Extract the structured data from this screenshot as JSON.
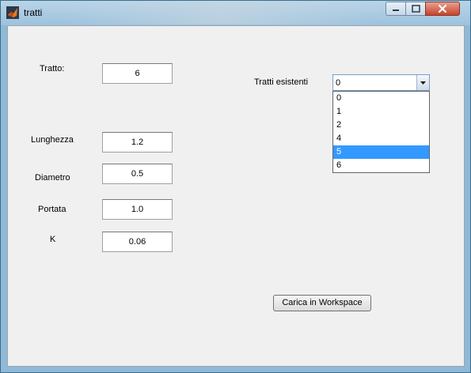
{
  "window": {
    "title": "tratti",
    "icon": "matlab-icon",
    "controls": [
      "minimize-icon",
      "maximize-icon",
      "close-icon"
    ]
  },
  "form": {
    "tratto_label": "Tratto:",
    "tratto_value": "6",
    "lunghezza_label": "Lunghezza",
    "lunghezza_value": "1.2",
    "diametro_label": "Diametro",
    "diametro_value": "0.5",
    "portata_label": "Portata",
    "portata_value": "1.0",
    "k_label": "K",
    "k_value": "0.06"
  },
  "existing": {
    "label": "Tratti esistenti",
    "selected_value": "0",
    "options": [
      "0",
      "1",
      "2",
      "4",
      "5",
      "6"
    ],
    "highlighted_option": "5"
  },
  "actions": {
    "load_button_label": "Carica in Workspace"
  },
  "colors": {
    "selection": "#3399ff",
    "client_bg": "#f0f0f0",
    "close_button": "#c7422b"
  }
}
